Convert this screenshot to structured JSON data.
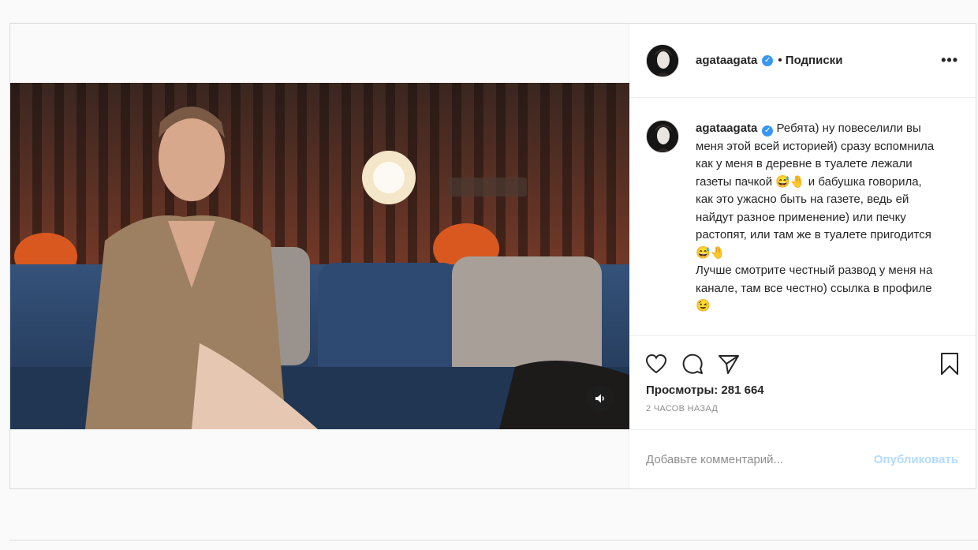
{
  "post": {
    "username": "agataagata",
    "follow_label": "• Подписки",
    "more_label": "•••",
    "caption": "Ребята) ну повеселили вы меня этой всей историей) сразу вспомнила как у меня в деревне в туалете лежали газеты пачкой 😅🤚 и бабушка говорила, как это ужасно быть на газете, ведь ей найдут разное применение) или печку растопят, или там же в туалете пригодится😅🤚\nЛучше смотрите честный развод у меня на канале, там все честно) ссылка в профиле 😉",
    "views": "Просмотры: 281 664",
    "time": "2 ЧАСОВ НАЗАД",
    "comment_placeholder": "Добавьте комментарий...",
    "publish_label": "Опубликовать"
  },
  "icons": {
    "verified": "verified-badge-icon",
    "like": "heart-icon",
    "comment": "comment-icon",
    "share": "paper-plane-icon",
    "save": "bookmark-icon",
    "sound": "speaker-icon"
  },
  "colors": {
    "accent": "#3897f0",
    "publish_disabled": "#b3dbff",
    "meta": "#8e8e8e",
    "border": "#dbdbdb"
  }
}
